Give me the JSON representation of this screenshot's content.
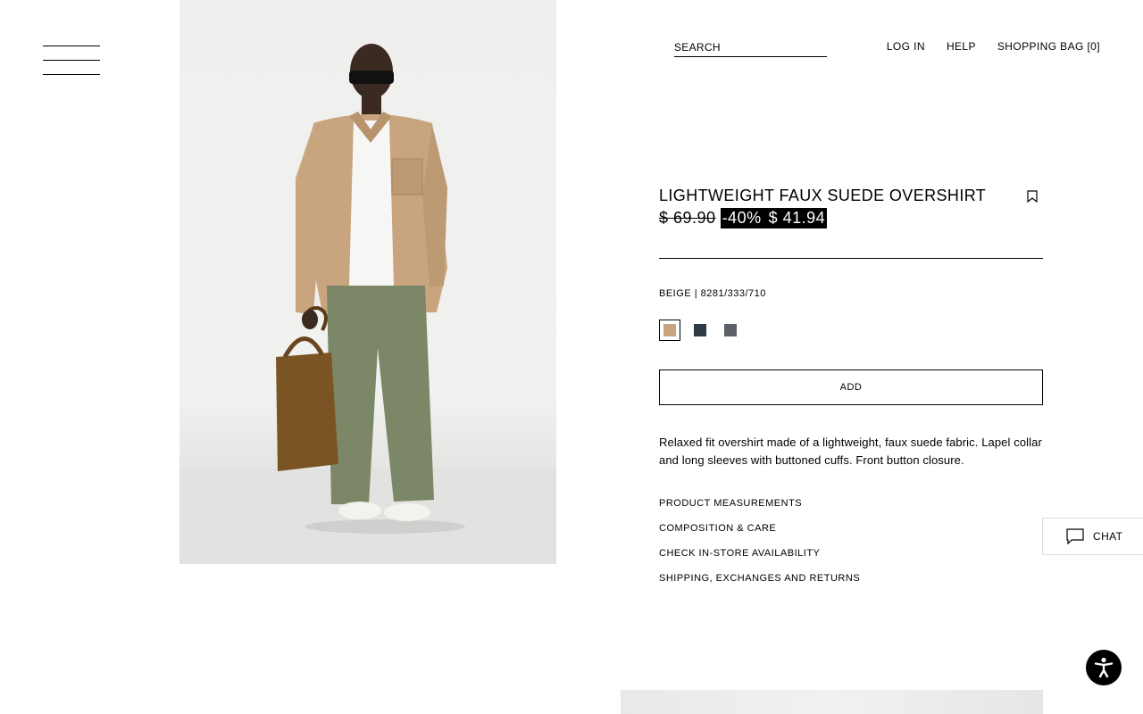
{
  "header": {
    "search_placeholder": "SEARCH",
    "nav": {
      "login": "LOG IN",
      "help": "HELP",
      "bag": "SHOPPING BAG [0]"
    }
  },
  "product": {
    "title": "LIGHTWEIGHT FAUX SUEDE OVERSHIRT",
    "original_price": "$ 69.90",
    "discount": "-40%",
    "sale_price": "$ 41.94",
    "color_name": "BEIGE",
    "color_separator": "|",
    "reference": "8281/333/710",
    "swatches": [
      {
        "name": "beige",
        "color": "#c8a57e",
        "selected": true
      },
      {
        "name": "navy",
        "color": "#2e3a46",
        "selected": false
      },
      {
        "name": "grey",
        "color": "#5c6168",
        "selected": false
      }
    ],
    "add_label": "ADD",
    "description": "Relaxed fit overshirt made of a lightweight, faux suede fabric. Lapel collar and long sleeves with buttoned cuffs. Front button closure.",
    "info_links": [
      "PRODUCT MEASUREMENTS",
      "COMPOSITION & CARE",
      "CHECK IN-STORE AVAILABILITY",
      "SHIPPING, EXCHANGES AND RETURNS"
    ]
  },
  "chat": {
    "label": "CHAT"
  },
  "icons": {
    "menu": "hamburger-menu-icon",
    "bookmark": "bookmark-icon",
    "chat": "chat-bubble-icon",
    "accessibility": "accessibility-icon"
  },
  "colors": {
    "text": "#000000",
    "background": "#ffffff",
    "sale_bg": "#000000",
    "sale_text": "#ffffff"
  }
}
